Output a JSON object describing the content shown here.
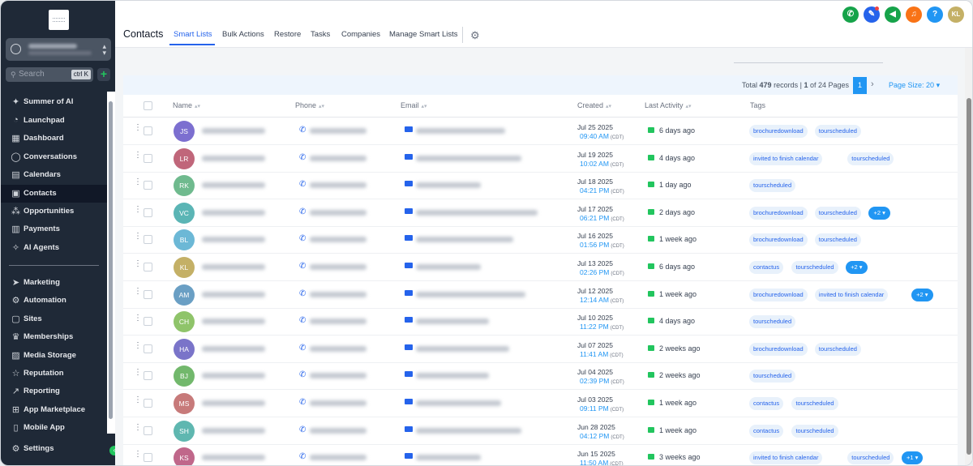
{
  "sidebar": {
    "search_placeholder": "Search",
    "search_shortcut": "ctrl K",
    "add_symbol": "+",
    "items": [
      {
        "name": "summer-of-ai",
        "label": "Summer of AI",
        "icon": "✦"
      },
      {
        "name": "launchpad",
        "label": "Launchpad",
        "icon": "◔"
      },
      {
        "name": "dashboard",
        "label": "Dashboard",
        "icon": "▦"
      },
      {
        "name": "conversations",
        "label": "Conversations",
        "icon": "◯"
      },
      {
        "name": "calendars",
        "label": "Calendars",
        "icon": "▤"
      },
      {
        "name": "contacts",
        "label": "Contacts",
        "icon": "▣"
      },
      {
        "name": "opportunities",
        "label": "Opportunities",
        "icon": "⁂"
      },
      {
        "name": "payments",
        "label": "Payments",
        "icon": "▥"
      },
      {
        "name": "ai-agents",
        "label": "AI Agents",
        "icon": "✧"
      },
      {
        "name": "marketing",
        "label": "Marketing",
        "icon": "➤"
      },
      {
        "name": "automation",
        "label": "Automation",
        "icon": "⚙"
      },
      {
        "name": "sites",
        "label": "Sites",
        "icon": "▢"
      },
      {
        "name": "memberships",
        "label": "Memberships",
        "icon": "♛"
      },
      {
        "name": "media-storage",
        "label": "Media Storage",
        "icon": "▨"
      },
      {
        "name": "reputation",
        "label": "Reputation",
        "icon": "☆"
      },
      {
        "name": "reporting",
        "label": "Reporting",
        "icon": "↗"
      },
      {
        "name": "app-marketplace",
        "label": "App Marketplace",
        "icon": "⊞"
      },
      {
        "name": "mobile-app",
        "label": "Mobile App",
        "icon": "▯"
      },
      {
        "name": "settings",
        "label": "Settings",
        "icon": "⚙"
      }
    ]
  },
  "header": {
    "title": "Contacts",
    "tabs": [
      "Smart Lists",
      "Bulk Actions",
      "Restore",
      "Tasks",
      "Companies",
      "Manage Smart Lists"
    ],
    "active_tab": "Smart Lists",
    "buttons": [
      {
        "name": "phone-button",
        "icon": "✆",
        "color": "#16a34a"
      },
      {
        "name": "ticket-button",
        "icon": "✎",
        "color": "#2563eb"
      },
      {
        "name": "announcement-button",
        "icon": "◀",
        "color": "#16a34a"
      },
      {
        "name": "notifications-button",
        "icon": "♫",
        "color": "#f97316"
      },
      {
        "name": "help-button",
        "icon": "?",
        "color": "#2196f3"
      },
      {
        "name": "user-avatar",
        "icon": "KL",
        "color": "#c4b066"
      }
    ]
  },
  "pagination": {
    "total_prefix": "Total ",
    "total_count": "479",
    "total_mid": " records | ",
    "page_current": "1",
    "page_suffix": " of 24 Pages",
    "current_page_button": "1",
    "next_icon": "›",
    "page_size_label": "Page Size: 20",
    "page_size_chevron": "▾"
  },
  "table": {
    "columns": [
      "Name",
      "Phone",
      "Email",
      "Created",
      "Last Activity",
      "Tags"
    ],
    "rows": [
      {
        "initials": "JS",
        "color": "#7c6fd0",
        "date": "Jul 25 2025",
        "time": "09:40 AM",
        "tz": "(CDT)",
        "activity": "6 days ago",
        "tags": [
          "brochuredownload",
          "tourscheduled"
        ],
        "more": ""
      },
      {
        "initials": "LR",
        "color": "#c0667a",
        "date": "Jul 19 2025",
        "time": "10:02 AM",
        "tz": "(CDT)",
        "activity": "4 days ago",
        "tags": [
          "invited to finish calendar",
          "tourscheduled"
        ],
        "more": ""
      },
      {
        "initials": "RK",
        "color": "#6fba8e",
        "date": "Jul 18 2025",
        "time": "04:21 PM",
        "tz": "(CDT)",
        "activity": "1 day ago",
        "tags": [
          "tourscheduled"
        ],
        "more": ""
      },
      {
        "initials": "VC",
        "color": "#5bb5b5",
        "date": "Jul 17 2025",
        "time": "06:21 PM",
        "tz": "(CDT)",
        "activity": "2 days ago",
        "tags": [
          "brochuredownload",
          "tourscheduled"
        ],
        "more": "+2"
      },
      {
        "initials": "BL",
        "color": "#6cb8d6",
        "date": "Jul 16 2025",
        "time": "01:56 PM",
        "tz": "(CDT)",
        "activity": "1 week ago",
        "tags": [
          "brochuredownload",
          "tourscheduled"
        ],
        "more": ""
      },
      {
        "initials": "KL",
        "color": "#c4b066",
        "date": "Jul 13 2025",
        "time": "02:26 PM",
        "tz": "(CDT)",
        "activity": "6 days ago",
        "tags": [
          "contactus",
          "tourscheduled"
        ],
        "more": "+2"
      },
      {
        "initials": "AM",
        "color": "#6a9fc4",
        "date": "Jul 12 2025",
        "time": "12:14 AM",
        "tz": "(CDT)",
        "activity": "1 week ago",
        "tags": [
          "brochuredownload",
          "invited to finish calendar"
        ],
        "more": "+2"
      },
      {
        "initials": "CH",
        "color": "#8fc46a",
        "date": "Jul 10 2025",
        "time": "11:22 PM",
        "tz": "(CDT)",
        "activity": "4 days ago",
        "tags": [
          "tourscheduled"
        ],
        "more": ""
      },
      {
        "initials": "HA",
        "color": "#7a74c9",
        "date": "Jul 07 2025",
        "time": "11:41 AM",
        "tz": "(CDT)",
        "activity": "2 weeks ago",
        "tags": [
          "brochuredownload",
          "tourscheduled"
        ],
        "more": ""
      },
      {
        "initials": "BJ",
        "color": "#72b86c",
        "date": "Jul 04 2025",
        "time": "02:39 PM",
        "tz": "(CDT)",
        "activity": "2 weeks ago",
        "tags": [
          "tourscheduled"
        ],
        "more": ""
      },
      {
        "initials": "MS",
        "color": "#c77a7a",
        "date": "Jul 03 2025",
        "time": "09:11 PM",
        "tz": "(CDT)",
        "activity": "1 week ago",
        "tags": [
          "contactus",
          "tourscheduled"
        ],
        "more": ""
      },
      {
        "initials": "SH",
        "color": "#5fb7b0",
        "date": "Jun 28 2025",
        "time": "04:12 PM",
        "tz": "(CDT)",
        "activity": "1 week ago",
        "tags": [
          "contactus",
          "tourscheduled"
        ],
        "more": ""
      },
      {
        "initials": "KS",
        "color": "#c0678a",
        "date": "Jun 15 2025",
        "time": "11:50 AM",
        "tz": "(CDT)",
        "activity": "3 weeks ago",
        "tags": [
          "invited to finish calendar",
          "tourscheduled"
        ],
        "more": "+1"
      }
    ]
  }
}
